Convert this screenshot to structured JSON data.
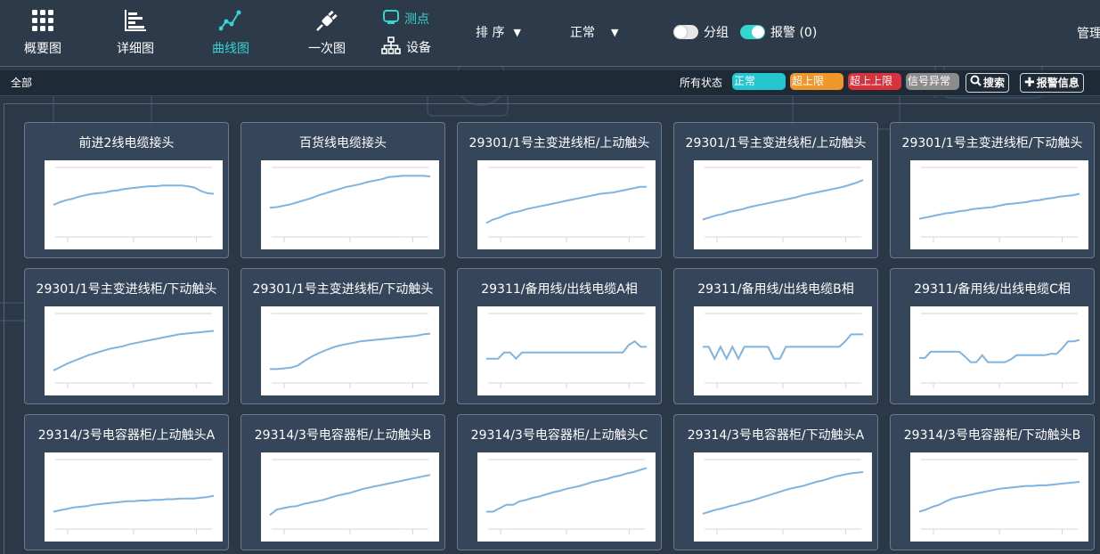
{
  "nav": {
    "items": [
      {
        "label": "概要图",
        "icon": "grid-icon",
        "active": false
      },
      {
        "label": "详细图",
        "icon": "bar-detail-icon",
        "active": false
      },
      {
        "label": "曲线图",
        "icon": "line-chart-icon",
        "active": true
      },
      {
        "label": "一次图",
        "icon": "plug-icon",
        "active": false
      }
    ],
    "measure_point": {
      "label": "测点",
      "icon": "monitor-icon"
    },
    "device": {
      "label": "设备",
      "icon": "org-tree-icon"
    },
    "sort": {
      "label": "排 序"
    },
    "status_filter": {
      "label": "正常"
    },
    "group_toggle": {
      "label": "分组",
      "on": false
    },
    "alarm_toggle": {
      "label": "报警 (0)",
      "on": true
    },
    "manage": {
      "label": "管理"
    }
  },
  "filter_bar": {
    "all": "全部",
    "status_label": "所有状态",
    "chips": [
      {
        "label": "正常",
        "color": "#24c6d0"
      },
      {
        "label": "超上限",
        "color": "#f0972c"
      },
      {
        "label": "超上上限",
        "color": "#d8323c"
      },
      {
        "label": "信号异常",
        "color": "#8c8c8c"
      }
    ],
    "search_button": "搜索",
    "alarm_info_button": "报警信息"
  },
  "colors": {
    "accent": "#34d4cf",
    "line": "#7fb3e0"
  },
  "cards": [
    {
      "title": "前进2线电缆接头",
      "values": [
        46,
        50,
        53,
        55,
        58,
        60,
        62,
        63,
        64,
        66,
        67,
        69,
        70,
        71,
        72,
        73,
        73,
        74,
        74,
        74,
        74,
        73,
        71,
        66,
        63,
        62
      ]
    },
    {
      "title": "百货线电缆接头",
      "values": [
        42,
        43,
        45,
        47,
        50,
        53,
        56,
        60,
        63,
        66,
        69,
        72,
        74,
        76,
        79,
        81,
        83,
        86,
        87,
        88,
        88,
        88,
        88,
        87
      ]
    },
    {
      "title": "29301/1号主变进线柜/上动触头",
      "values": [
        20,
        25,
        28,
        32,
        35,
        37,
        40,
        42,
        44,
        46,
        48,
        50,
        52,
        54,
        56,
        58,
        60,
        62,
        63,
        64,
        66,
        68,
        70,
        72,
        72
      ]
    },
    {
      "title": "29301/1号主变进线柜/上动触头",
      "values": [
        25,
        28,
        31,
        33,
        36,
        38,
        40,
        43,
        45,
        47,
        49,
        51,
        53,
        55,
        57,
        60,
        62,
        64,
        66,
        68,
        70,
        72,
        75,
        78,
        82
      ]
    },
    {
      "title": "29301/1号主变进线柜/下动触头",
      "values": [
        26,
        28,
        30,
        32,
        34,
        35,
        37,
        38,
        40,
        41,
        42,
        43,
        45,
        47,
        48,
        49,
        50,
        52,
        53,
        55,
        56,
        58,
        59,
        60,
        62
      ]
    },
    {
      "title": "29301/1号主变进线柜/下动触头",
      "values": [
        18,
        23,
        28,
        32,
        36,
        40,
        43,
        46,
        49,
        51,
        53,
        56,
        58,
        60,
        62,
        64,
        66,
        68,
        70,
        71,
        72,
        73,
        74,
        75
      ]
    },
    {
      "title": "29301/1号主变进线柜/下动触头",
      "values": [
        20,
        20,
        21,
        22,
        25,
        32,
        38,
        43,
        47,
        51,
        54,
        56,
        58,
        60,
        61,
        62,
        63,
        64,
        65,
        66,
        67,
        68,
        70,
        71
      ]
    },
    {
      "title": "29311/备用线/出线电缆A相",
      "values": [
        35,
        35,
        35,
        44,
        44,
        35,
        44,
        44,
        44,
        44,
        44,
        44,
        44,
        44,
        44,
        44,
        44,
        44,
        44,
        44,
        44,
        44,
        44,
        44,
        55,
        60,
        52,
        52
      ]
    },
    {
      "title": "29311/备用线/出线电缆B相",
      "values": [
        52,
        52,
        35,
        52,
        35,
        52,
        35,
        52,
        52,
        52,
        52,
        52,
        35,
        35,
        52,
        52,
        52,
        52,
        52,
        52,
        52,
        52,
        52,
        52,
        60,
        70,
        70,
        70
      ]
    },
    {
      "title": "29311/备用线/出线电缆C相",
      "values": [
        36,
        36,
        45,
        45,
        45,
        45,
        45,
        45,
        38,
        30,
        30,
        40,
        30,
        30,
        30,
        30,
        34,
        40,
        40,
        40,
        40,
        40,
        40,
        42,
        42,
        50,
        60,
        60,
        62
      ]
    },
    {
      "title": "29314/3号电容器柜/上动触头A",
      "values": [
        25,
        27,
        29,
        31,
        32,
        33,
        35,
        36,
        37,
        38,
        39,
        40,
        40,
        41,
        41,
        42,
        42,
        43,
        43,
        44,
        44,
        44,
        45,
        46,
        48
      ]
    },
    {
      "title": "29314/3号电容器柜/上动触头B",
      "values": [
        20,
        28,
        30,
        32,
        33,
        36,
        38,
        40,
        42,
        45,
        48,
        50,
        52,
        55,
        58,
        60,
        62,
        64,
        66,
        68,
        70,
        72,
        74,
        76,
        78
      ]
    },
    {
      "title": "29314/3号电容器柜/上动触头C",
      "values": [
        25,
        25,
        30,
        35,
        35,
        40,
        42,
        45,
        47,
        50,
        53,
        55,
        58,
        60,
        62,
        65,
        68,
        70,
        72,
        75,
        77,
        80,
        82,
        85,
        88
      ]
    },
    {
      "title": "29314/3号电容器柜/下动触头A",
      "values": [
        22,
        25,
        28,
        30,
        33,
        35,
        38,
        40,
        43,
        46,
        49,
        52,
        55,
        58,
        60,
        62,
        65,
        68,
        70,
        73,
        76,
        78,
        80,
        81,
        82
      ]
    },
    {
      "title": "29314/3号电容器柜/下动触头B",
      "values": [
        25,
        28,
        32,
        35,
        40,
        44,
        46,
        48,
        50,
        52,
        54,
        56,
        58,
        59,
        60,
        61,
        62,
        62,
        63,
        63,
        64,
        65,
        66,
        67,
        68
      ]
    }
  ]
}
